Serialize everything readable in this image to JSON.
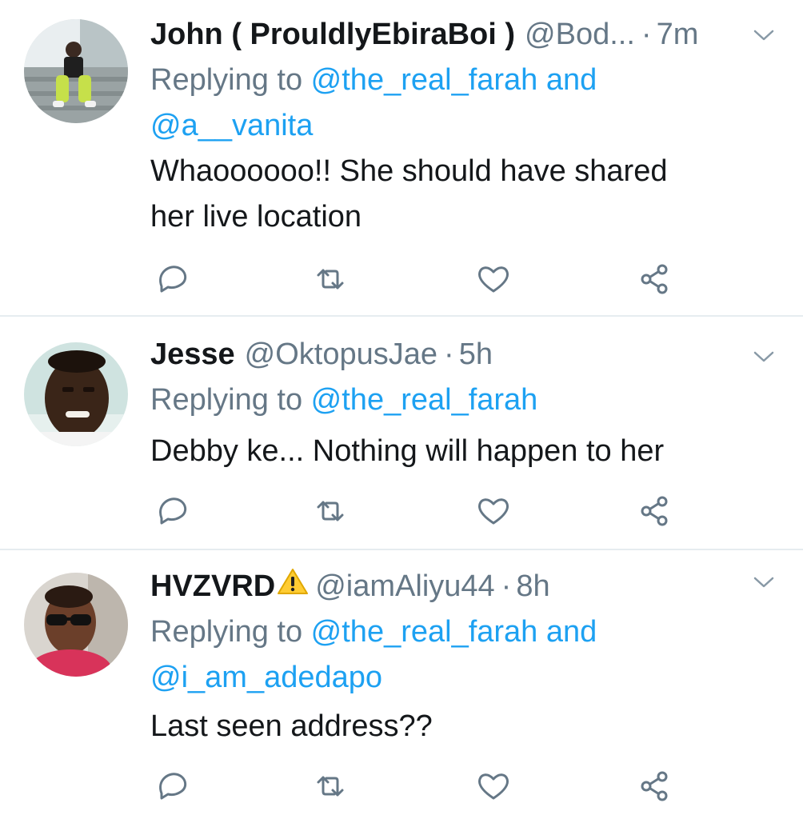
{
  "tweets": [
    {
      "name": "John ( ProuldlyEbiraBoi )",
      "handle": "@Bod...",
      "dot": "·",
      "time": "7m",
      "replying_prefix": "Replying to ",
      "reply_user1": "@the_real_farah",
      "reply_joiner": " and",
      "reply_user2": "@a__vanita",
      "text_line1": "Whaoooooo!!  She should have shared",
      "text_line2": "her live location"
    },
    {
      "name": "Jesse",
      "handle": "@OktopusJae",
      "dot": "·",
      "time": "5h",
      "replying_prefix": "Replying to ",
      "reply_user1": "@the_real_farah",
      "text_line1": "Debby ke... Nothing will happen to her"
    },
    {
      "name": "HVZVRD",
      "name_emoji": "warning-sign-emoji",
      "handle": "@iamAliyu44",
      "dot": "·",
      "time": "8h",
      "replying_prefix": "Replying to ",
      "reply_user1": "@the_real_farah",
      "reply_joiner": " and",
      "reply_user2": "@i_am_adedapo",
      "text_line1": "Last seen address??"
    }
  ],
  "icons": {
    "reply": "reply-icon",
    "retweet": "retweet-icon",
    "like": "like-icon",
    "share": "share-icon",
    "more": "chevron-down-icon"
  },
  "colors": {
    "text": "#14171a",
    "secondary": "#657786",
    "link": "#1da1f2",
    "divider": "#e6ecf0"
  }
}
